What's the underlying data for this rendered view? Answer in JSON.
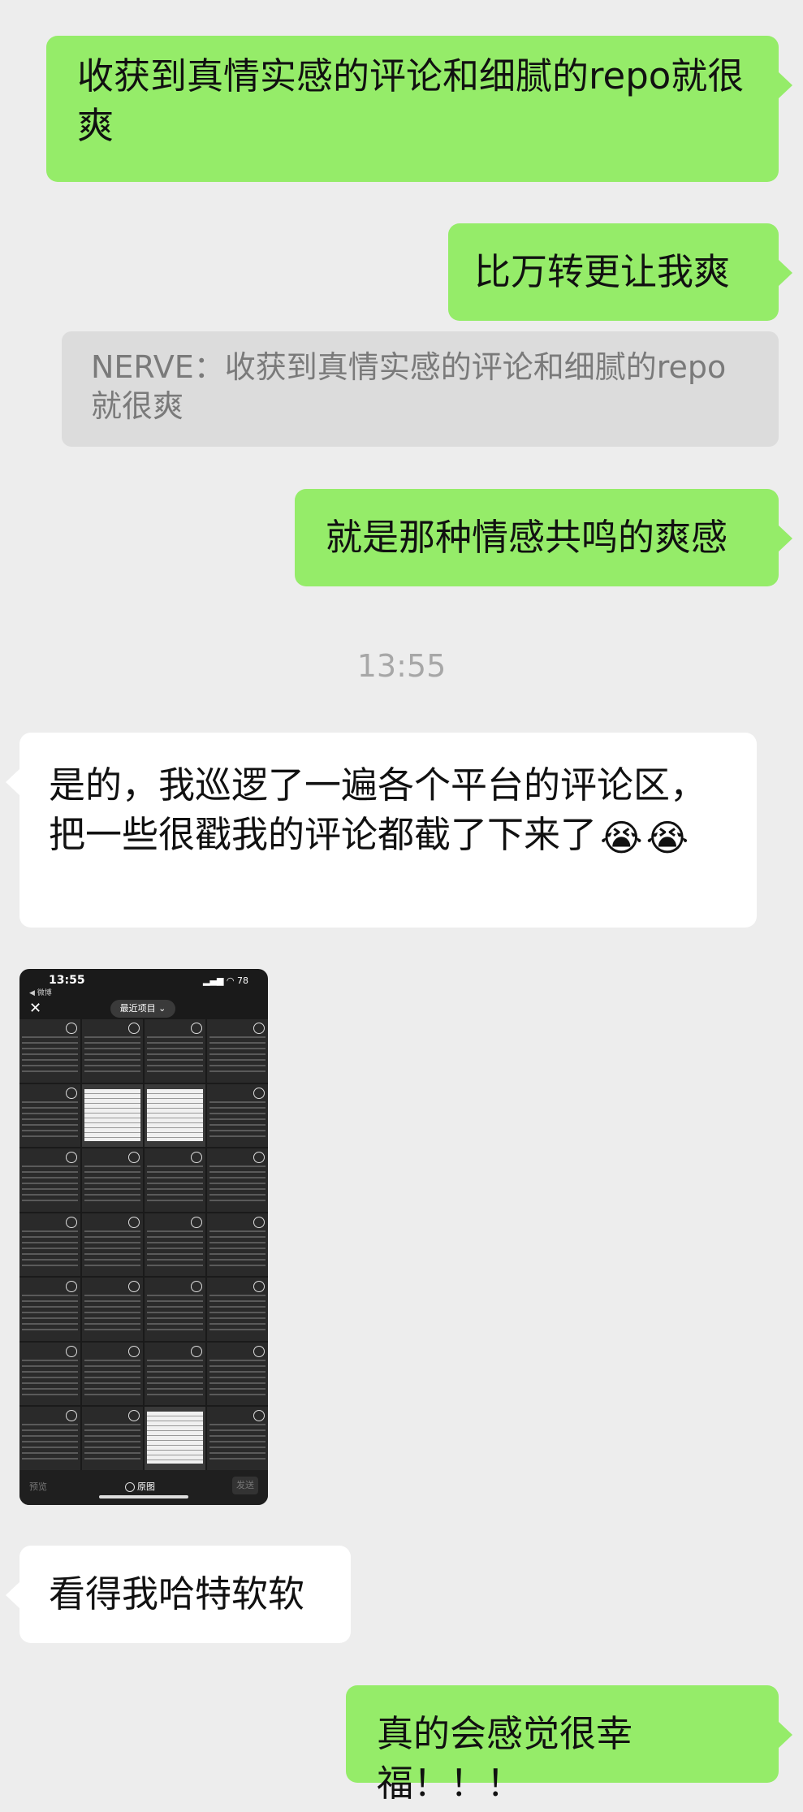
{
  "messages": {
    "m1": "收获到真情实感的评论和细腻的repo就很爽",
    "m2": "比万转更让我爽",
    "quote": "NERVE：收获到真情实感的评论和细腻的repo就很爽",
    "m3": "就是那种情感共鸣的爽感",
    "timestamp": "13:55",
    "m4": "是的，我巡逻了一遍各个平台的评论区，把一些很戳我的评论都截了下来了",
    "m5": "看得我哈特软软",
    "m6": "真的会感觉很幸福！！！"
  },
  "emoji": {
    "crying": "😭"
  },
  "thumbnail": {
    "status_time": "13:55",
    "status_right": "▂▄▆ ◠ 78",
    "back_label": "◀ 微博",
    "album_label": "最近项目 ⌄",
    "preview_label": "预览",
    "original_label": "原图",
    "send_label": "发送"
  },
  "colors": {
    "background": "#ededed",
    "self_bubble": "#95ec69",
    "other_bubble": "#ffffff",
    "quote_bg": "#dcdcdc"
  }
}
